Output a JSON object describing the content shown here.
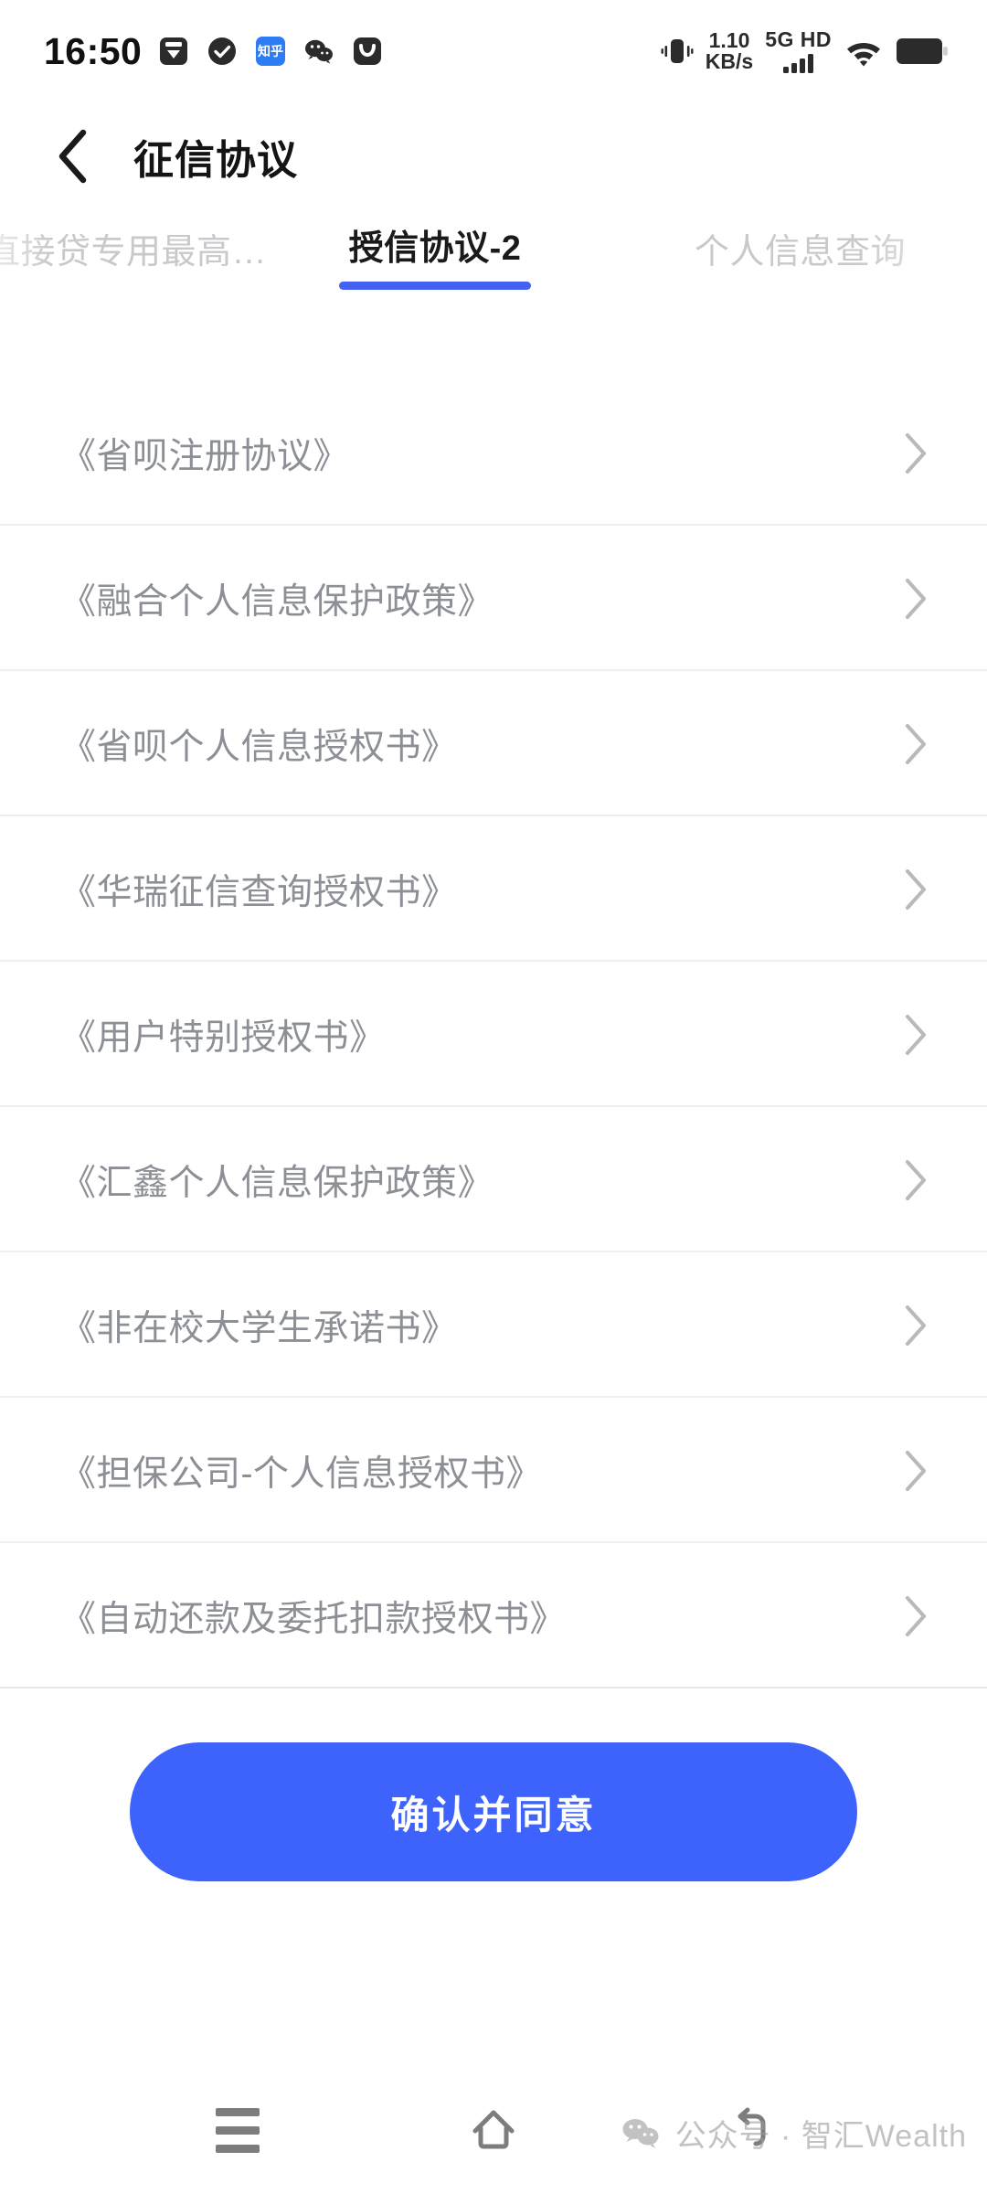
{
  "status_bar": {
    "time": "16:50",
    "app_icons": [
      {
        "name": "save-app-icon"
      },
      {
        "name": "check-circle-app-icon"
      },
      {
        "name": "zhihu-app-icon",
        "label": "知乎"
      },
      {
        "name": "wechat-app-icon"
      },
      {
        "name": "mail-app-icon"
      }
    ],
    "vibrate_icon": "vibrate-icon",
    "net_speed_value": "1.10",
    "net_speed_unit": "KB/s",
    "network_label": "5G HD",
    "signal_bars": 4,
    "wifi_icon": "wifi-icon",
    "battery_icon": "battery-icon"
  },
  "header": {
    "back_icon": "chevron-left-icon",
    "title": "征信协议"
  },
  "tabs": {
    "active_index": 1,
    "items": [
      {
        "label": "直接贷专用最高…",
        "active": false
      },
      {
        "label": "授信协议-2",
        "active": true
      },
      {
        "label": "个人信息查询",
        "active": false
      }
    ]
  },
  "agreements": [
    {
      "label": "《省呗注册协议》"
    },
    {
      "label": "《融合个人信息保护政策》"
    },
    {
      "label": "《省呗个人信息授权书》"
    },
    {
      "label": "《华瑞征信查询授权书》"
    },
    {
      "label": "《用户特别授权书》"
    },
    {
      "label": "《汇鑫个人信息保护政策》"
    },
    {
      "label": "《非在校大学生承诺书》"
    },
    {
      "label": "《担保公司-个人信息授权书》"
    },
    {
      "label": "《自动还款及委托扣款授权书》"
    }
  ],
  "cta": {
    "label": "确认并同意"
  },
  "android_nav": {
    "recents_icon": "menu-icon",
    "home_icon": "home-icon",
    "back_icon": "back-arrow-icon"
  },
  "watermark": {
    "icon": "wechat-icon",
    "text": "公众号 · 智汇Wealth"
  },
  "colors": {
    "accent_blue": "#3d63fc",
    "tab_underline": "#4461f2",
    "list_text": "#8c9096",
    "title_text": "#141414"
  }
}
